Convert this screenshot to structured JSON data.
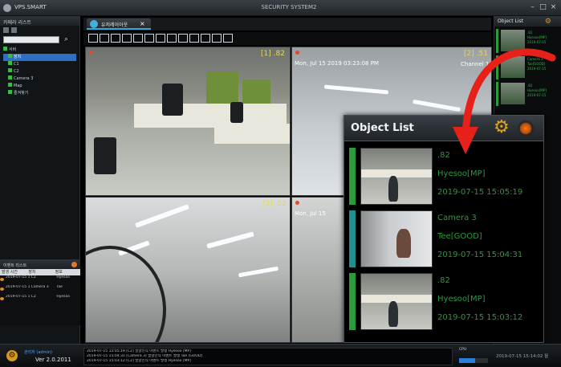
{
  "app": {
    "name": "VPS.SMART",
    "window_title": "SECURITY SYSTEM2"
  },
  "left_panel": {
    "header": "카메라 리스트",
    "tree": [
      {
        "label": "서버",
        "selected": false
      },
      {
        "label": "장치",
        "selected": true
      },
      {
        "label": "C1",
        "selected": false
      },
      {
        "label": "C2",
        "selected": false
      },
      {
        "label": "Camera 3",
        "selected": false
      },
      {
        "label": "Map",
        "selected": false
      },
      {
        "label": "즐겨찾기",
        "selected": false
      }
    ]
  },
  "event_panel": {
    "header": "이벤트 리스트",
    "columns": [
      "발생 시간",
      "장치",
      "정보"
    ],
    "rows": [
      {
        "time": "2019-07-15 15:05:19",
        "device": "C2",
        "info": "Hyesoo"
      },
      {
        "time": "2019-07-15 15:04:31",
        "device": "Camera 3",
        "info": "Tae"
      },
      {
        "time": "2019-07-15 15:03:12",
        "device": "C2",
        "info": "Hyesoo"
      }
    ]
  },
  "bottom_bar": {
    "user": "관리자 (admin)",
    "version": "Ver 2.0.2011",
    "log_lines": [
      "2019-07-15 15:05:19 [C2] 얼굴인식 이벤트 발생 Hyesoo [MP]",
      "2019-07-15 15:04:31 [Camera 3] 얼굴인식 이벤트 발생 Tae [GOOD]",
      "2019-07-15 15:03:12 [C2] 얼굴인식 이벤트 발생 Hyesoo [MP]"
    ],
    "cpu_label": "CPU",
    "cpu_fraction": 0.55,
    "clock": "2019-07-15 15:14:02 월"
  },
  "view_tab": {
    "label": "유저레이아웃"
  },
  "toolbar": {
    "icons": [
      "layout-1-icon",
      "layout-4-icon",
      "layout-6-icon",
      "layout-8-icon",
      "layout-9-icon",
      "layout-13-icon",
      "layout-16-icon",
      "layout-25-icon",
      "layout-36-icon",
      "rotate-icon",
      "sequence-icon",
      "fit-icon",
      "fullscreen-icon"
    ]
  },
  "cameras": [
    {
      "channel": "[1] .82",
      "timestamp": ""
    },
    {
      "channel": "[2] .51",
      "timestamp": "Mon, Jul 15 2019 03:23:08 PM",
      "name": "Channel 1"
    },
    {
      "channel": "[3] .52",
      "timestamp": ""
    },
    {
      "channel": "",
      "timestamp": "Mon, Jul 15"
    }
  ],
  "right_panel": {
    "header": "Object List",
    "items": [
      {
        "line1": ".82",
        "line2": "Hyesoo[MP]",
        "line3": "2019-07-15"
      },
      {
        "line1": "Camera 3",
        "line2": "Tae[GOOD]",
        "line3": "2019-07-15"
      },
      {
        "line1": ".82",
        "line2": "Hyesoo[MP]",
        "line3": "2019-07-15"
      }
    ]
  },
  "object_list": {
    "title": "Object List",
    "items": [
      {
        "source": ".82",
        "name": "Hyesoo[MP]",
        "time": "2019-07-15 15:05:19",
        "stripe_color": "#2a9a3a",
        "thumb": "office"
      },
      {
        "source": "Camera 3",
        "name": "Tee[GOOD]",
        "time": "2019-07-15 15:04:31",
        "stripe_color": "#1f8f8f",
        "thumb": "wall"
      },
      {
        "source": ".82",
        "name": "Hyesoo[MP]",
        "time": "2019-07-15 15:03:12",
        "stripe_color": "#2a9a3a",
        "thumb": "office"
      }
    ]
  },
  "colors": {
    "accent_green": "#2a9a3a",
    "accent_teal": "#1f8f8f",
    "arrow_red": "#e8201a",
    "gear_orange": "#e3a21f",
    "channel_yellow": "#f0d44a"
  }
}
